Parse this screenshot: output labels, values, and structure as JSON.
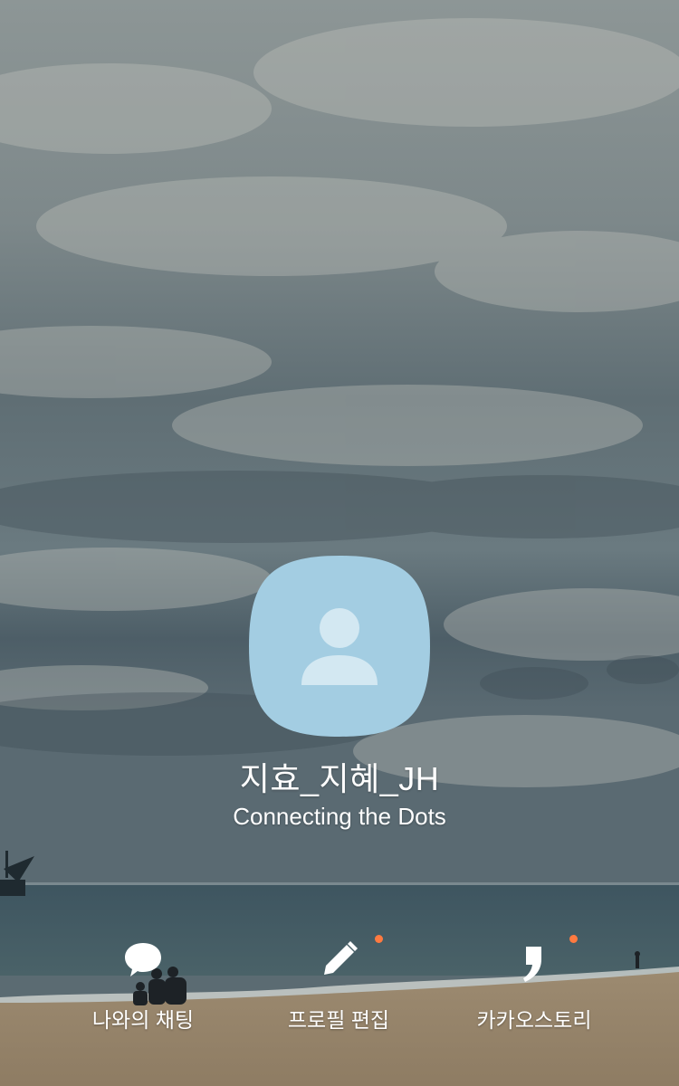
{
  "profile": {
    "name": "지효_지혜_JH",
    "status_message": "Connecting the Dots"
  },
  "actions": [
    {
      "label": "나와의 채팅",
      "icon": "speech-bubble-icon",
      "has_badge": false
    },
    {
      "label": "프로필 편집",
      "icon": "pencil-icon",
      "has_badge": true
    },
    {
      "label": "카카오스토리",
      "icon": "kakaostory-comma-icon",
      "has_badge": true
    }
  ],
  "colors": {
    "avatar_bg": "#a3cde2",
    "avatar_glyph": "#d3e8f2",
    "badge": "#ff7a40",
    "text": "#ffffff"
  }
}
